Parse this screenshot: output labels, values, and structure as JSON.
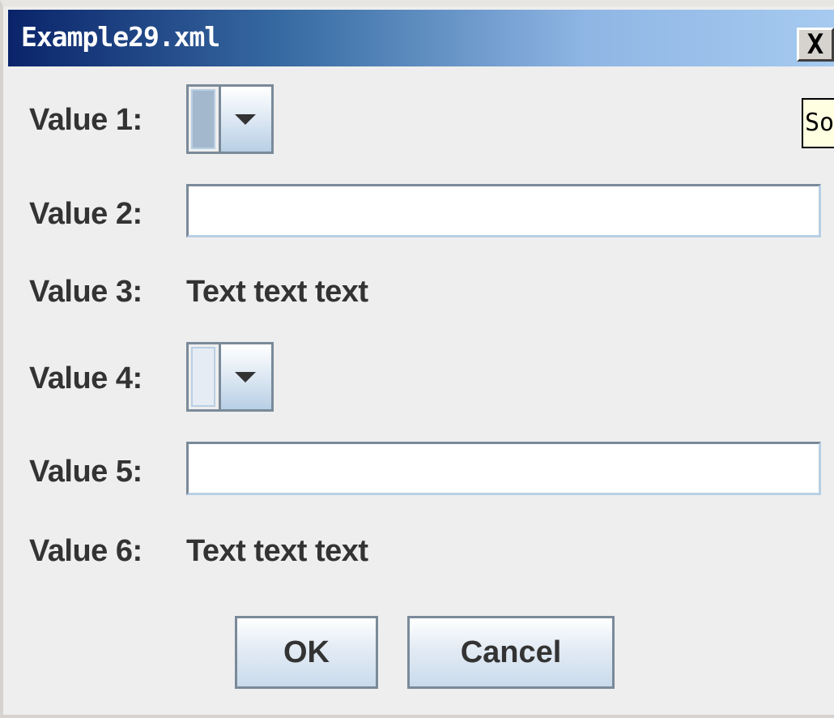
{
  "window": {
    "title": "Example29.xml",
    "close_label": "X"
  },
  "form": {
    "rows": [
      {
        "label": "Value 1:",
        "type": "combo",
        "fill": "filled"
      },
      {
        "label": "Value 2:",
        "type": "text",
        "value": ""
      },
      {
        "label": "Value 3:",
        "type": "static",
        "text": "Text text text"
      },
      {
        "label": "Value 4:",
        "type": "combo",
        "fill": "empty"
      },
      {
        "label": "Value 5:",
        "type": "text",
        "value": ""
      },
      {
        "label": "Value 6:",
        "type": "static",
        "text": "Text text text"
      }
    ]
  },
  "buttons": {
    "ok_label": "OK",
    "cancel_label": "Cancel"
  },
  "tooltip": {
    "text": "So"
  },
  "colors": {
    "title_gradient_start": "#0a246a",
    "title_gradient_end": "#a6caf0",
    "panel_bg": "#eeeeee",
    "control_border": "#7a8a99",
    "tooltip_bg": "#ffffe1"
  }
}
